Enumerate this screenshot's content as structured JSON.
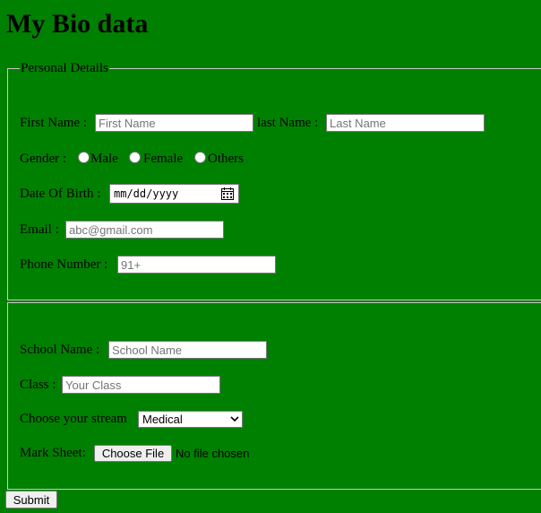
{
  "page_title": "My Bio data",
  "personal": {
    "legend": "Personal Details",
    "first_name_label": "First Name :",
    "first_name_placeholder": "First Name",
    "last_name_label": "last Name :",
    "last_name_placeholder": "Last Name",
    "gender_label": "Gender :",
    "gender_options": [
      "Male",
      "Female",
      "Others"
    ],
    "dob_label": "Date Of Birth :",
    "dob_placeholder": "mm/dd/yyyy",
    "email_label": "Email :",
    "email_placeholder": "abc@gmail.com",
    "phone_label": "Phone Number :",
    "phone_placeholder": "91+"
  },
  "school": {
    "school_name_label": "School Name :",
    "school_name_placeholder": "School Name",
    "class_label": "Class :",
    "class_placeholder": "Your Class",
    "stream_label": "Choose your stream",
    "stream_selected": "Medical",
    "marksheet_label": "Mark Sheet:",
    "choose_file_label": "Choose File",
    "no_file_text": "No file chosen"
  },
  "submit_label": "Submit",
  "colors": {
    "background": "#008000",
    "fieldset_border": "#c9c9c9",
    "input_border": "#767676",
    "button_bg": "#efefef"
  }
}
